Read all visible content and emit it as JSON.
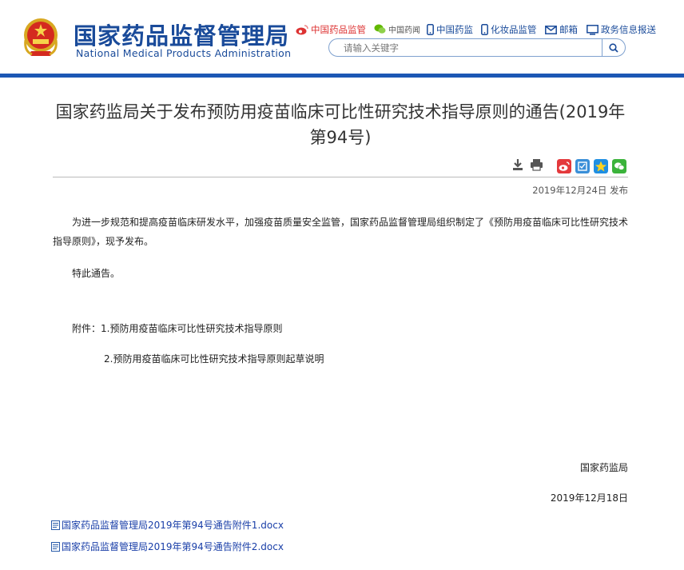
{
  "header": {
    "title_cn": "国家药品监督管理局",
    "title_en": "National Medical Products Administration",
    "links": [
      {
        "label": "中国药品监管",
        "icon": "weibo-icon"
      },
      {
        "label": "中国药闻",
        "icon": "wechat-icon"
      },
      {
        "label": "中国药监",
        "icon": "mobile-icon"
      },
      {
        "label": "化妆品监管",
        "icon": "mobile-icon"
      },
      {
        "label": "邮箱",
        "icon": "mail-icon"
      },
      {
        "label": "政务信息报送",
        "icon": "monitor-icon"
      }
    ],
    "search_placeholder": "请输入关键字"
  },
  "article": {
    "title": "国家药监局关于发布预防用疫苗临床可比性研究技术指导原则的通告(2019年第94号)",
    "publish_date": "2019年12月24日 发布",
    "para1": "为进一步规范和提高疫苗临床研发水平，加强疫苗质量安全监管，国家药品监督管理局组织制定了《预防用疫苗临床可比性研究技术指导原则》，现予发布。",
    "para2": "特此通告。",
    "attachment1": "附件：1.预防用疫苗临床可比性研究技术指导原则",
    "attachment2": "2.预防用疫苗临床可比性研究技术指导原则起草说明",
    "signer": "国家药监局",
    "sign_date": "2019年12月18日",
    "files": [
      "国家药品监督管理局2019年第94号通告附件1.docx",
      "国家药品监督管理局2019年第94号通告附件2.docx"
    ]
  },
  "colors": {
    "brand_blue": "#1a4b9a",
    "bar_blue": "#1c57b4",
    "link_blue": "#1a3fa8"
  }
}
